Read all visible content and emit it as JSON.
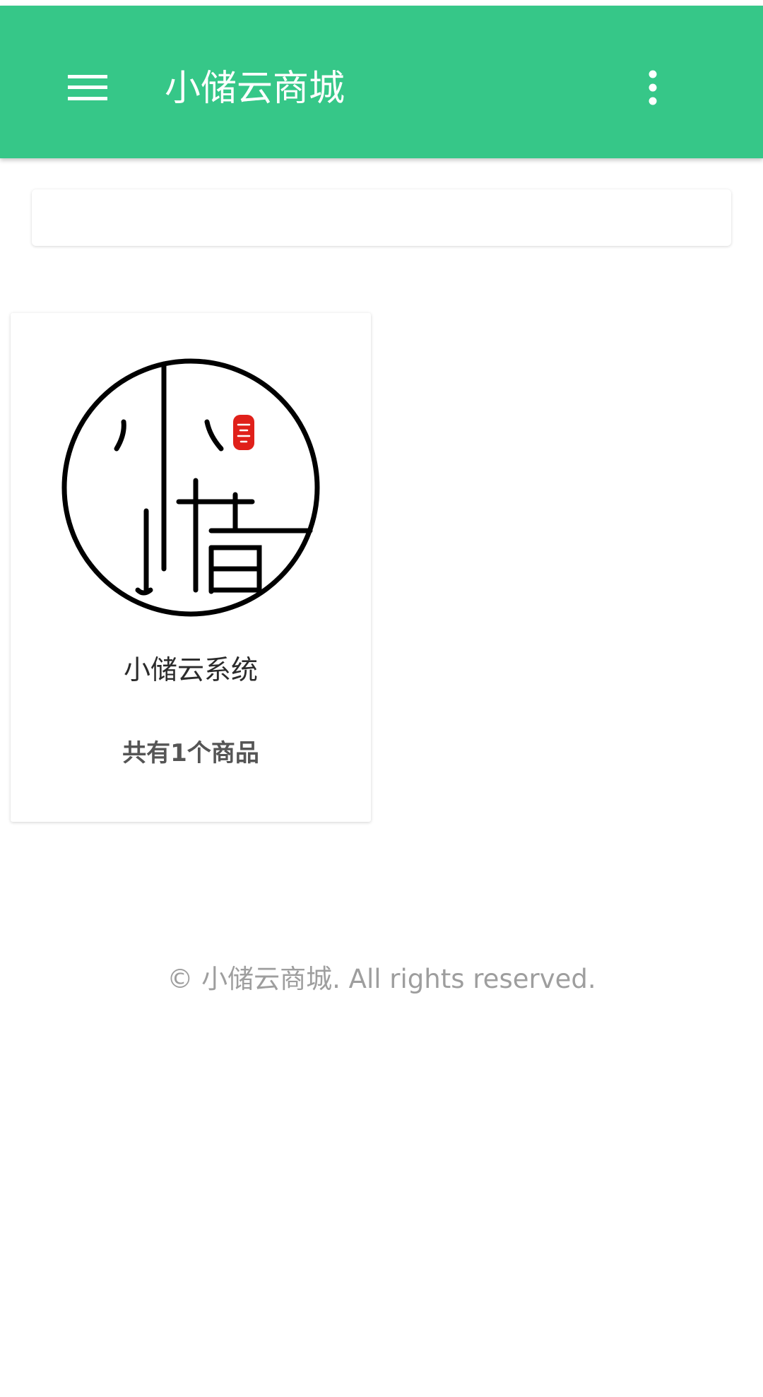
{
  "appbar": {
    "title": "小储云商城",
    "menu_icon": "menu-icon",
    "more_icon": "more-vert-icon",
    "color": "#36c788"
  },
  "search": {
    "placeholder": ""
  },
  "shops": [
    {
      "logo_icon": "xiaochu-logo",
      "logo_text": "小储",
      "seal_text": "商城",
      "name": "小储云系统",
      "count_label": "共有1个商品"
    }
  ],
  "footer": {
    "copyright": "© 小储云商城. All rights reserved."
  }
}
